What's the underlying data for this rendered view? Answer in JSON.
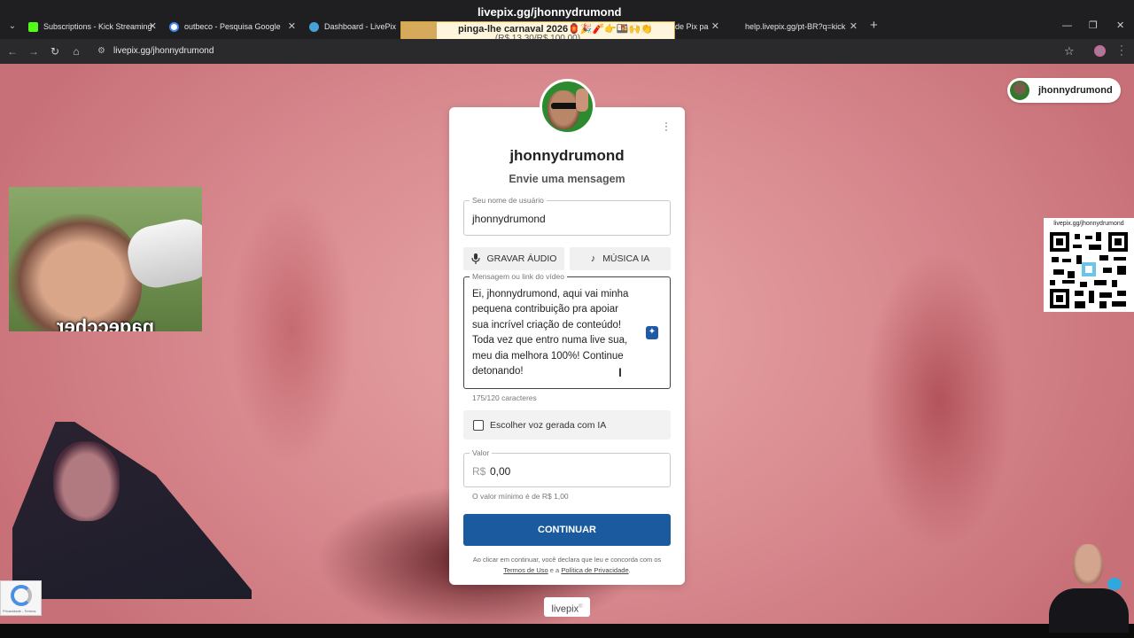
{
  "browser": {
    "overlay_title": "livepix.gg/jhonnydrumond",
    "tabs": [
      {
        "title": "Subscriptions - Kick Streaming",
        "favicon_color": "#53fc18"
      },
      {
        "title": "outbeco - Pesquisa Google",
        "favicon_color": "#4285f4"
      },
      {
        "title": "Dashboard - LivePix",
        "favicon_color": "#46a3d9"
      },
      {
        "title": "de Pix pa",
        "favicon_color": ""
      },
      {
        "title": "help.livepix.gg/pt-BR?q=kick",
        "favicon_color": ""
      }
    ],
    "notification": {
      "line1": "pinga-lhe carnaval 2026🏮🎉🧨👉🍱🙌👏",
      "line2": "(R$ 13,30/R$ 100,00)"
    },
    "url": "livepix.gg/jhonnydrumond"
  },
  "header": {
    "pill_name": "jhonnydrumond"
  },
  "overlays": {
    "meme_caption": "ɹǝɥɔɔǝbɐu",
    "qr_url": "livepix.gg/jhonnydrumond",
    "recaptcha_text": "Privacidade - Termos"
  },
  "card": {
    "name": "jhonnydrumond",
    "subtitle": "Envie uma mensagem",
    "username_field": {
      "label": "Seu nome de usuário",
      "value": "jhonnydrumond"
    },
    "record_audio_label": "GRAVAR ÁUDIO",
    "ai_music_label": "MÚSICA IA",
    "message_field": {
      "label": "Mensagem ou link do vídeo",
      "value": "Ei, jhonnydrumond, aqui vai minha pequena contribuição pra apoiar sua incrível criação de conteúdo! Toda vez que entro numa live sua, meu dia melhora 100%! Continue detonando!"
    },
    "char_count": "175/120 caracteres",
    "ai_voice_label": "Escolher voz gerada com IA",
    "value_field": {
      "label": "Valor",
      "currency": "R$",
      "amount": "0,00"
    },
    "min_note": "O valor mínimo é de R$ 1,00",
    "continue_label": "CONTINUAR",
    "terms": {
      "prefix": "Ao clicar em continuar, você declara que leu e concorda com os",
      "terms_link": "Termos de Uso",
      "conj": "e a",
      "privacy_link": "Política de Privacidade",
      "suffix": "."
    }
  },
  "footer": {
    "logo_text": "livepix",
    "logo_mark": "®"
  },
  "colors": {
    "primary": "#1c5aa0",
    "ai_accent": "#1f5aa6"
  }
}
